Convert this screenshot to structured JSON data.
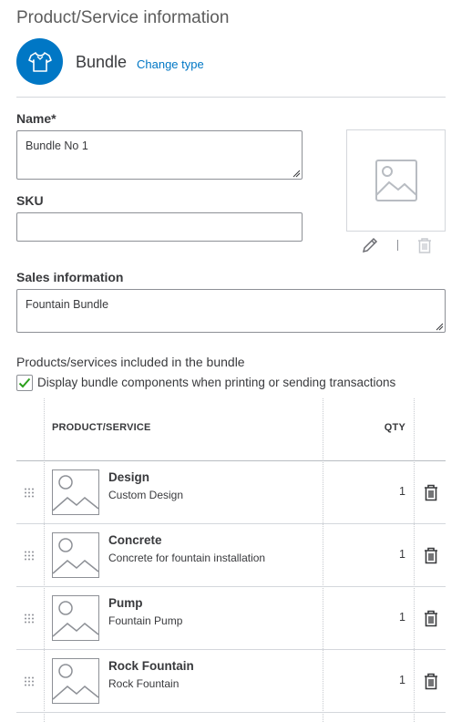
{
  "header": {
    "title": "Product/Service information",
    "type_icon": "shirt-icon",
    "type_label": "Bundle",
    "change_type_link": "Change type"
  },
  "form": {
    "name": {
      "label": "Name*",
      "value": "Bundle No 1"
    },
    "sku": {
      "label": "SKU",
      "value": ""
    },
    "image": {
      "placeholder_icon": "image-placeholder-icon",
      "edit_icon": "pencil-icon",
      "delete_icon": "trash-icon"
    },
    "sales": {
      "label": "Sales information",
      "value": "Fountain Bundle"
    }
  },
  "bundle": {
    "heading": "Products/services included in the bundle",
    "display_components": {
      "checked": true,
      "label": "Display bundle components when printing or sending transactions"
    },
    "columns": {
      "product": "PRODUCT/SERVICE",
      "qty": "QTY"
    },
    "items": [
      {
        "name": "Design",
        "description": "Custom Design",
        "qty": "1"
      },
      {
        "name": "Concrete",
        "description": "Concrete for fountain installation",
        "qty": "1"
      },
      {
        "name": "Pump",
        "description": "Fountain Pump",
        "qty": "1"
      },
      {
        "name": "Rock Fountain",
        "description": "Rock Fountain",
        "qty": "1"
      }
    ]
  },
  "colors": {
    "accent": "#0077c5",
    "check": "#2ca01c",
    "text": "#393a3d",
    "border": "#8d9096"
  }
}
